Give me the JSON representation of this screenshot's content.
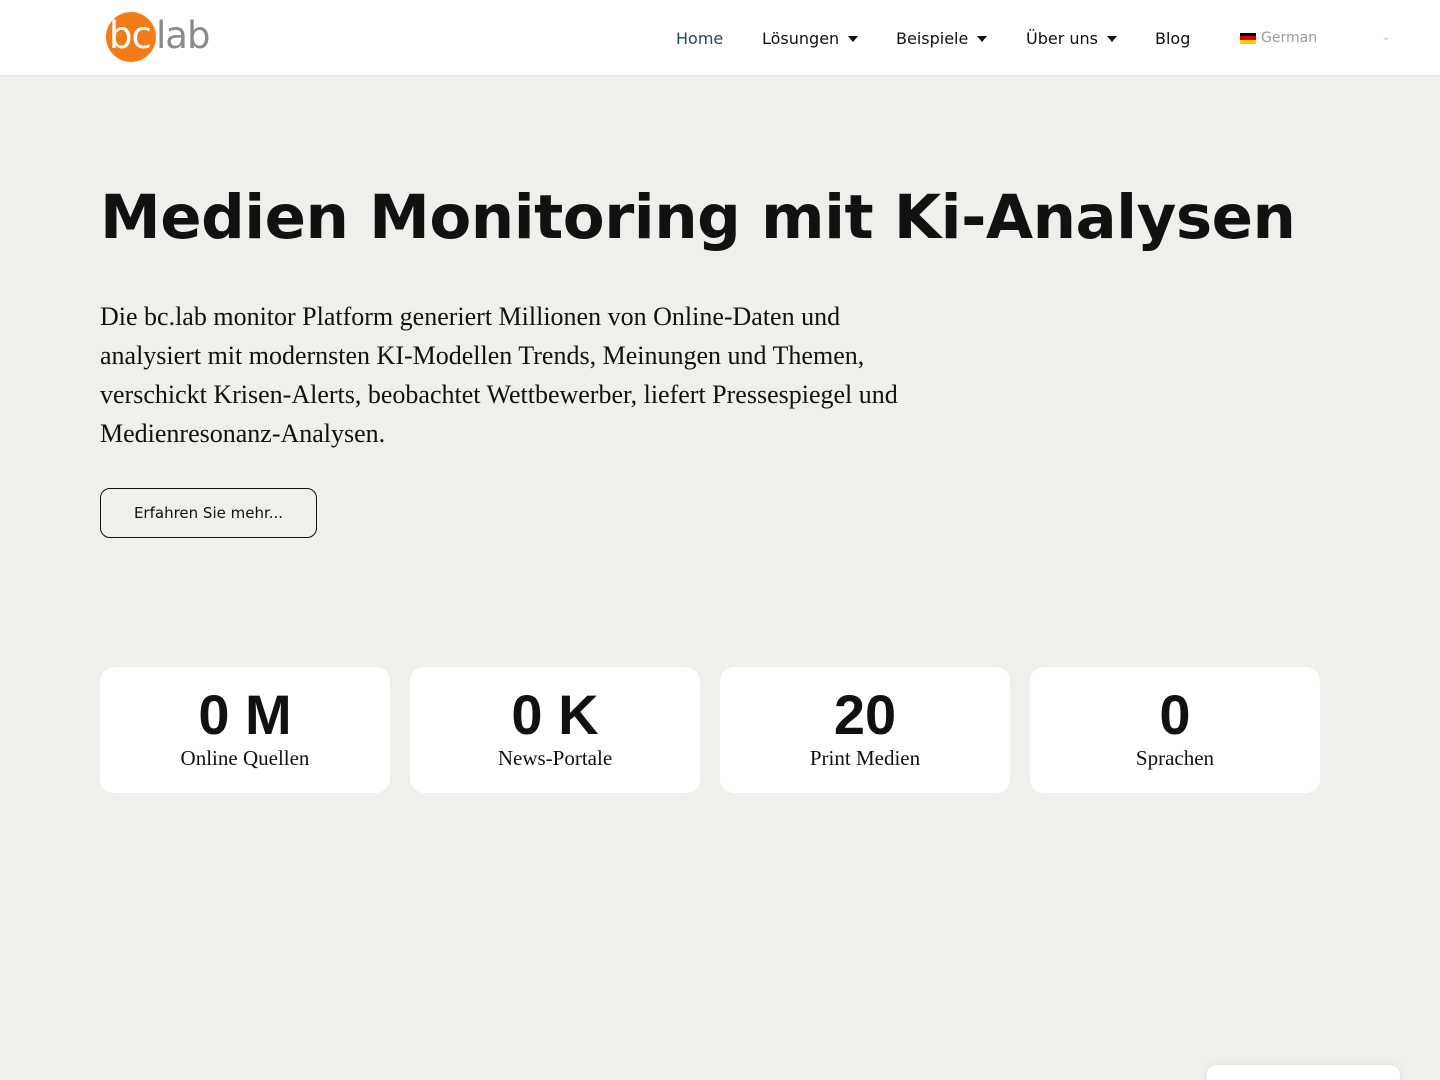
{
  "header": {
    "logo": {
      "part1": "bc",
      "part2": "lab",
      "accent": "#f47c18"
    },
    "nav": [
      {
        "label": "Home",
        "active": true,
        "dropdown": false
      },
      {
        "label": "Lösungen",
        "active": false,
        "dropdown": true
      },
      {
        "label": "Beispiele",
        "active": false,
        "dropdown": true
      },
      {
        "label": "Über uns",
        "active": false,
        "dropdown": true
      },
      {
        "label": "Blog",
        "active": false,
        "dropdown": false
      }
    ],
    "language": {
      "label": "German",
      "flag_icon": "germany-flag-icon"
    }
  },
  "hero": {
    "title": "Medien Monitoring mit Ki-Analysen",
    "text": "Die bc.lab monitor Platform generiert Millionen von Online-Daten und analysiert mit modernsten KI-Modellen Trends, Meinungen und Themen, verschickt Krisen-Alerts, beobachtet Wettbewerber, liefert Pressespiegel und Medienresonanz-Analysen.",
    "cta_label": "Erfahren Sie mehr..."
  },
  "stats": [
    {
      "value": "0 M",
      "label": "Online Quellen"
    },
    {
      "value": "0 K",
      "label": "News-Portale"
    },
    {
      "value": "20",
      "label": "Print Medien"
    },
    {
      "value": "0",
      "label": "Sprachen"
    }
  ]
}
